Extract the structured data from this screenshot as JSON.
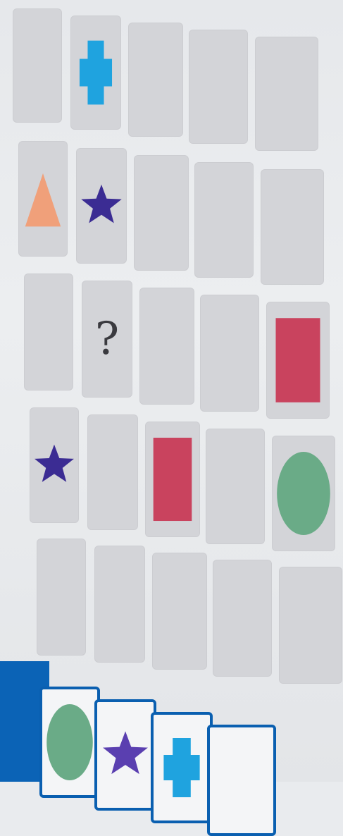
{
  "board": {
    "rows": 5,
    "cols": 5,
    "cells": [
      {
        "row": 0,
        "col": 0,
        "shape": "empty"
      },
      {
        "row": 0,
        "col": 1,
        "shape": "cross",
        "color": "#1fa3df"
      },
      {
        "row": 0,
        "col": 2,
        "shape": "empty"
      },
      {
        "row": 0,
        "col": 3,
        "shape": "empty"
      },
      {
        "row": 0,
        "col": 4,
        "shape": "empty"
      },
      {
        "row": 1,
        "col": 0,
        "shape": "triangle",
        "color": "#f0a07a"
      },
      {
        "row": 1,
        "col": 1,
        "shape": "star",
        "color": "#3b2c93"
      },
      {
        "row": 1,
        "col": 2,
        "shape": "empty"
      },
      {
        "row": 1,
        "col": 3,
        "shape": "empty"
      },
      {
        "row": 1,
        "col": 4,
        "shape": "empty"
      },
      {
        "row": 2,
        "col": 0,
        "shape": "empty"
      },
      {
        "row": 2,
        "col": 1,
        "shape": "question",
        "label": "?"
      },
      {
        "row": 2,
        "col": 2,
        "shape": "empty"
      },
      {
        "row": 2,
        "col": 3,
        "shape": "empty"
      },
      {
        "row": 2,
        "col": 4,
        "shape": "rectangle",
        "color": "#c9435e"
      },
      {
        "row": 3,
        "col": 0,
        "shape": "star",
        "color": "#3b2c93"
      },
      {
        "row": 3,
        "col": 1,
        "shape": "empty"
      },
      {
        "row": 3,
        "col": 2,
        "shape": "rectangle",
        "color": "#c9435e"
      },
      {
        "row": 3,
        "col": 3,
        "shape": "empty"
      },
      {
        "row": 3,
        "col": 4,
        "shape": "circle",
        "color": "#6aab87"
      },
      {
        "row": 4,
        "col": 0,
        "shape": "empty"
      },
      {
        "row": 4,
        "col": 1,
        "shape": "empty"
      },
      {
        "row": 4,
        "col": 2,
        "shape": "empty"
      },
      {
        "row": 4,
        "col": 3,
        "shape": "empty"
      },
      {
        "row": 4,
        "col": 4,
        "shape": "empty"
      }
    ]
  },
  "answer_tray": {
    "options": [
      {
        "shape": "circle",
        "color": "#6aab87"
      },
      {
        "shape": "star",
        "color": "#5a3fb0"
      },
      {
        "shape": "cross",
        "color": "#1fa3df"
      },
      {
        "shape": "empty"
      }
    ]
  },
  "colors": {
    "tray_blue": "#0b63b6",
    "cell_gray": "#d3d4d8"
  }
}
